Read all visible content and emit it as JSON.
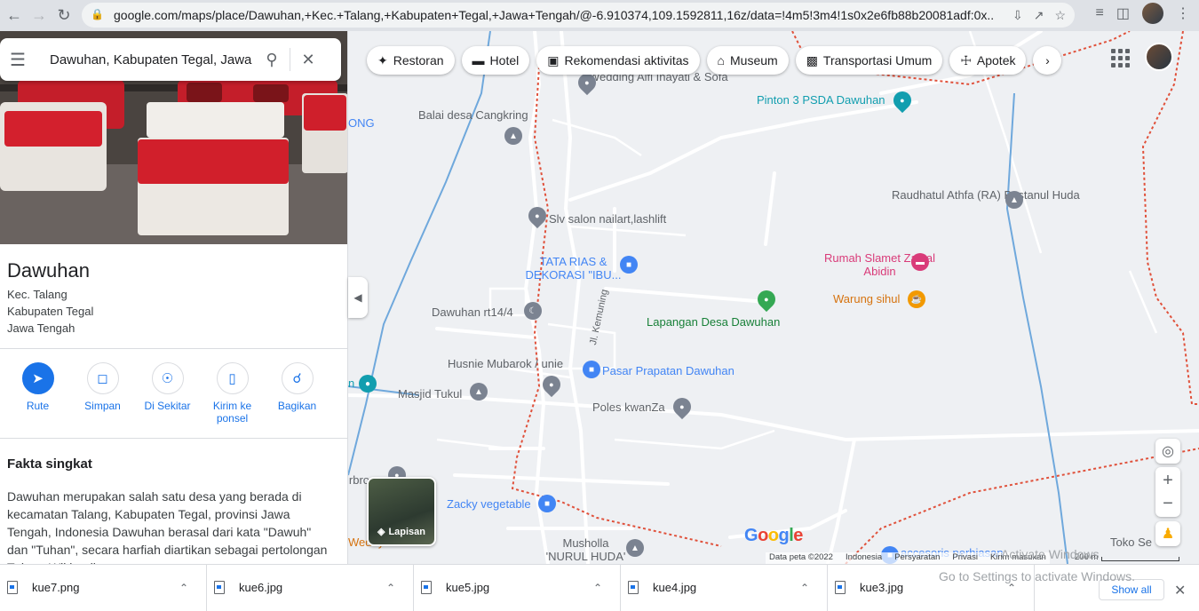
{
  "browser": {
    "url": "google.com/maps/place/Dawuhan,+Kec.+Talang,+Kabupaten+Tegal,+Jawa+Tengah/@-6.910374,109.1592811,16z/data=!4m5!3m4!1s0x2e6fb88b20081adf:0x..."
  },
  "search": {
    "value": "Dawuhan, Kabupaten Tegal, Jawa Tengah"
  },
  "place": {
    "title": "Dawuhan",
    "address_lines": [
      "Kec. Talang",
      "Kabupaten Tegal",
      "Jawa Tengah"
    ],
    "actions": [
      {
        "label": "Rute",
        "icon": "directions-icon"
      },
      {
        "label": "Simpan",
        "icon": "bookmark-icon"
      },
      {
        "label": "Di Sekitar",
        "icon": "nearby-icon"
      },
      {
        "label": "Kirim ke ponsel",
        "icon": "send-to-phone-icon"
      },
      {
        "label": "Bagikan",
        "icon": "share-icon"
      }
    ],
    "facts_title": "Fakta singkat",
    "facts_text": "Dawuhan merupakan salah satu desa yang berada di kecamatan Talang, Kabupaten Tegal, provinsi Jawa Tengah, Indonesia Dawuhan berasal dari kata \"Dawuh\" dan \"Tuhan\", secara harfiah diartikan sebagai pertolongan Tuhan. Wikipedia"
  },
  "chips": [
    "Restoran",
    "Hotel",
    "Rekomendasi aktivitas",
    "Museum",
    "Transportasi Umum",
    "Apotek"
  ],
  "map_labels": {
    "wedding": "Wedding Alfi Inayati & Sofa",
    "pinton": "Pinton 3 PSDA Dawuhan",
    "balai": "Balai desa Cangkring",
    "ong": "ONG",
    "raudhatul": "Raudhatul Athfa (RA) Bustanul Huda",
    "slv": "Slv salon nailart,lashlift",
    "tata_rias": "TATA RIAS & DEKORASI \"IBU...",
    "rumah_slamet": "Rumah Slamet Zainal Abidin",
    "warung": "Warung sihul",
    "dawuhan_rt": "Dawuhan rt14/4",
    "lapangan": "Lapangan Desa Dawuhan",
    "jl_kemuning": "Jl. Kemuning",
    "husnie": "Husnie Mubarok / unie",
    "pasar": "Pasar Prapatan Dawuhan",
    "masjid": "Masjid Tukul",
    "poles": "Poles kwanZa",
    "zacky": "Zacky vegetable",
    "musholla": "Musholla 'NURUL HUDA'",
    "toko": "Toko Se",
    "accesoris": "accesoris perhiasan",
    "irbro": "irbro",
    "wedey": "Wedey"
  },
  "layers_label": "Lapisan",
  "map_footer": {
    "data": "Data peta ©2022",
    "region": "Indonesia",
    "terms": "Persyaratan",
    "privacy": "Privasi",
    "feedback": "Kirim masukan",
    "scale": "200 m"
  },
  "watermark": {
    "line1": "Activate Windows",
    "line2": "Go to Settings to activate Windows."
  },
  "downloads": [
    "kue7.png",
    "kue6.jpg",
    "kue5.jpg",
    "kue4.jpg",
    "kue3.jpg"
  ],
  "show_all": "Show all",
  "colors": {
    "accent": "#1a73e8",
    "boundary": "#e0513b",
    "road": "#ffffff",
    "map_bg": "#eef0f3"
  }
}
